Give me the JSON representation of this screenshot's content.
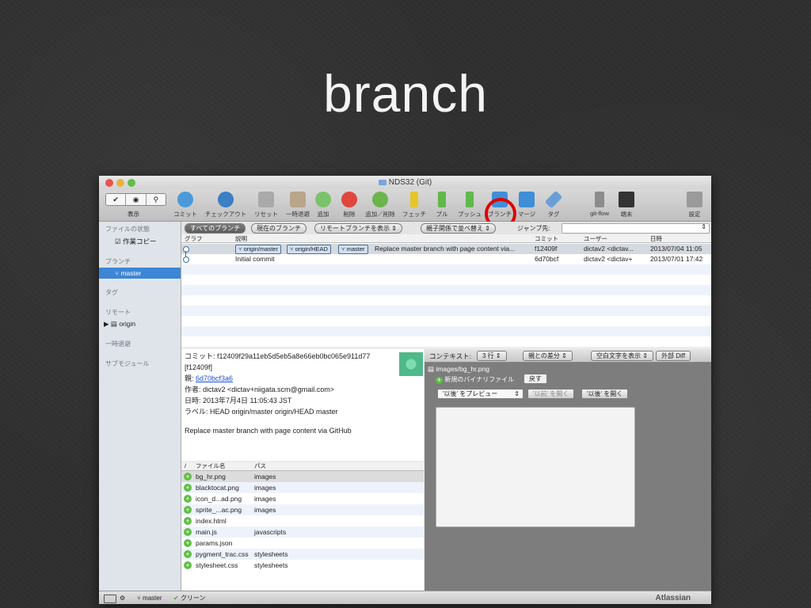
{
  "slide_title": "branch",
  "window_title": "NDS32 (Git)",
  "toolbar": {
    "view_label": "表示",
    "items": [
      {
        "label": "コミット",
        "color": "#4a9ad9"
      },
      {
        "label": "チェックアウト",
        "color": "#3c7fc4"
      },
      {
        "label": "リセット",
        "color": "#a9a9a9"
      },
      {
        "label": "一時退避",
        "color": "#b8a58a"
      },
      {
        "label": "追加",
        "color": "#7bc36a"
      },
      {
        "label": "削除",
        "color": "#e0463b"
      },
      {
        "label": "追加／削除",
        "color": "#6bb54c"
      },
      {
        "label": "フェッチ",
        "color": "#e6c52b"
      },
      {
        "label": "プル",
        "color": "#62b84a"
      },
      {
        "label": "プッシュ",
        "color": "#62b84a"
      },
      {
        "label": "ブランチ",
        "color": "#3f8ed6"
      },
      {
        "label": "マージ",
        "color": "#3f8ed6"
      },
      {
        "label": "タグ",
        "color": "#6a9fd6"
      },
      {
        "label": "git-flow",
        "color": "#8c8c8c"
      },
      {
        "label": "端末",
        "color": "#333333"
      },
      {
        "label": "設定",
        "color": "#9a9a9a"
      }
    ]
  },
  "sidebar": {
    "file_status": "ファイルの状態",
    "working_copy": "作業コピー",
    "branches": "ブランチ",
    "master": "master",
    "tags": "タグ",
    "remotes": "リモート",
    "origin": "origin",
    "stash": "一時退避",
    "submodules": "サブモジュール"
  },
  "filters": {
    "all_branches": "すべてのブランチ",
    "current_branch": "現在のブランチ",
    "show_remote": "リモートブランチを表示",
    "sort": "親子関係で並べ替え",
    "jump": "ジャンプ先:"
  },
  "graph": {
    "headers": {
      "graph": "グラフ",
      "desc": "説明",
      "commit": "コミット",
      "user": "ユーザー",
      "date": "日時"
    },
    "rows": [
      {
        "tags": [
          "origin/master",
          "origin/HEAD",
          "master"
        ],
        "desc": "Replace master branch with page content via...",
        "commit": "f12409f",
        "user": "dictav2 <dictav...",
        "date": "2013/07/04 11:05"
      },
      {
        "tags": [],
        "desc": "Initial commit",
        "commit": "6d70bcf",
        "user": "dictav2 <dictav+",
        "date": "2013/07/01 17:42"
      }
    ]
  },
  "details": {
    "commit": "コミット: f12409f29a11eb5d5eb5a8e66eb0bc065e911d77",
    "commit_short": "[f12409f]",
    "parent_label": "親: ",
    "parent": "6d70bcf3a6",
    "author": "作者: dictav2 <dictav+niigata.scm@gmail.com>",
    "date": "日時: 2013年7月4日 11:05:43 JST",
    "labels": "ラベル: HEAD origin/master origin/HEAD master",
    "message": "Replace master branch with page content via GitHub"
  },
  "files": {
    "headers": {
      "sort": "/",
      "name": "ファイル名",
      "path": "パス"
    },
    "rows": [
      {
        "name": "bg_hr.png",
        "path": "images"
      },
      {
        "name": "blacktocat.png",
        "path": "images"
      },
      {
        "name": "icon_d...ad.png",
        "path": "images"
      },
      {
        "name": "sprite_...ac.png",
        "path": "images"
      },
      {
        "name": "index.html",
        "path": ""
      },
      {
        "name": "main.js",
        "path": "javascripts"
      },
      {
        "name": "params.json",
        "path": ""
      },
      {
        "name": "pygment_trac.css",
        "path": "stylesheets"
      },
      {
        "name": "stylesheet.css",
        "path": "stylesheets"
      }
    ]
  },
  "diff": {
    "context_label": "コンテキスト:",
    "context_value": "3 行",
    "diff_parent": "親との差分",
    "whitespace": "空白文字を表示",
    "external": "外部 Diff",
    "file_path": "images/bg_hr.png",
    "new_binary": "新規のバイナリファイル",
    "discard": "戻す",
    "preview_select": "'以後' をプレビュー",
    "open_before": "'以前' を開く",
    "open_after": "'以後' を開く"
  },
  "status": {
    "branch": "master",
    "clean": "クリーン",
    "brand": "Atlassian"
  }
}
